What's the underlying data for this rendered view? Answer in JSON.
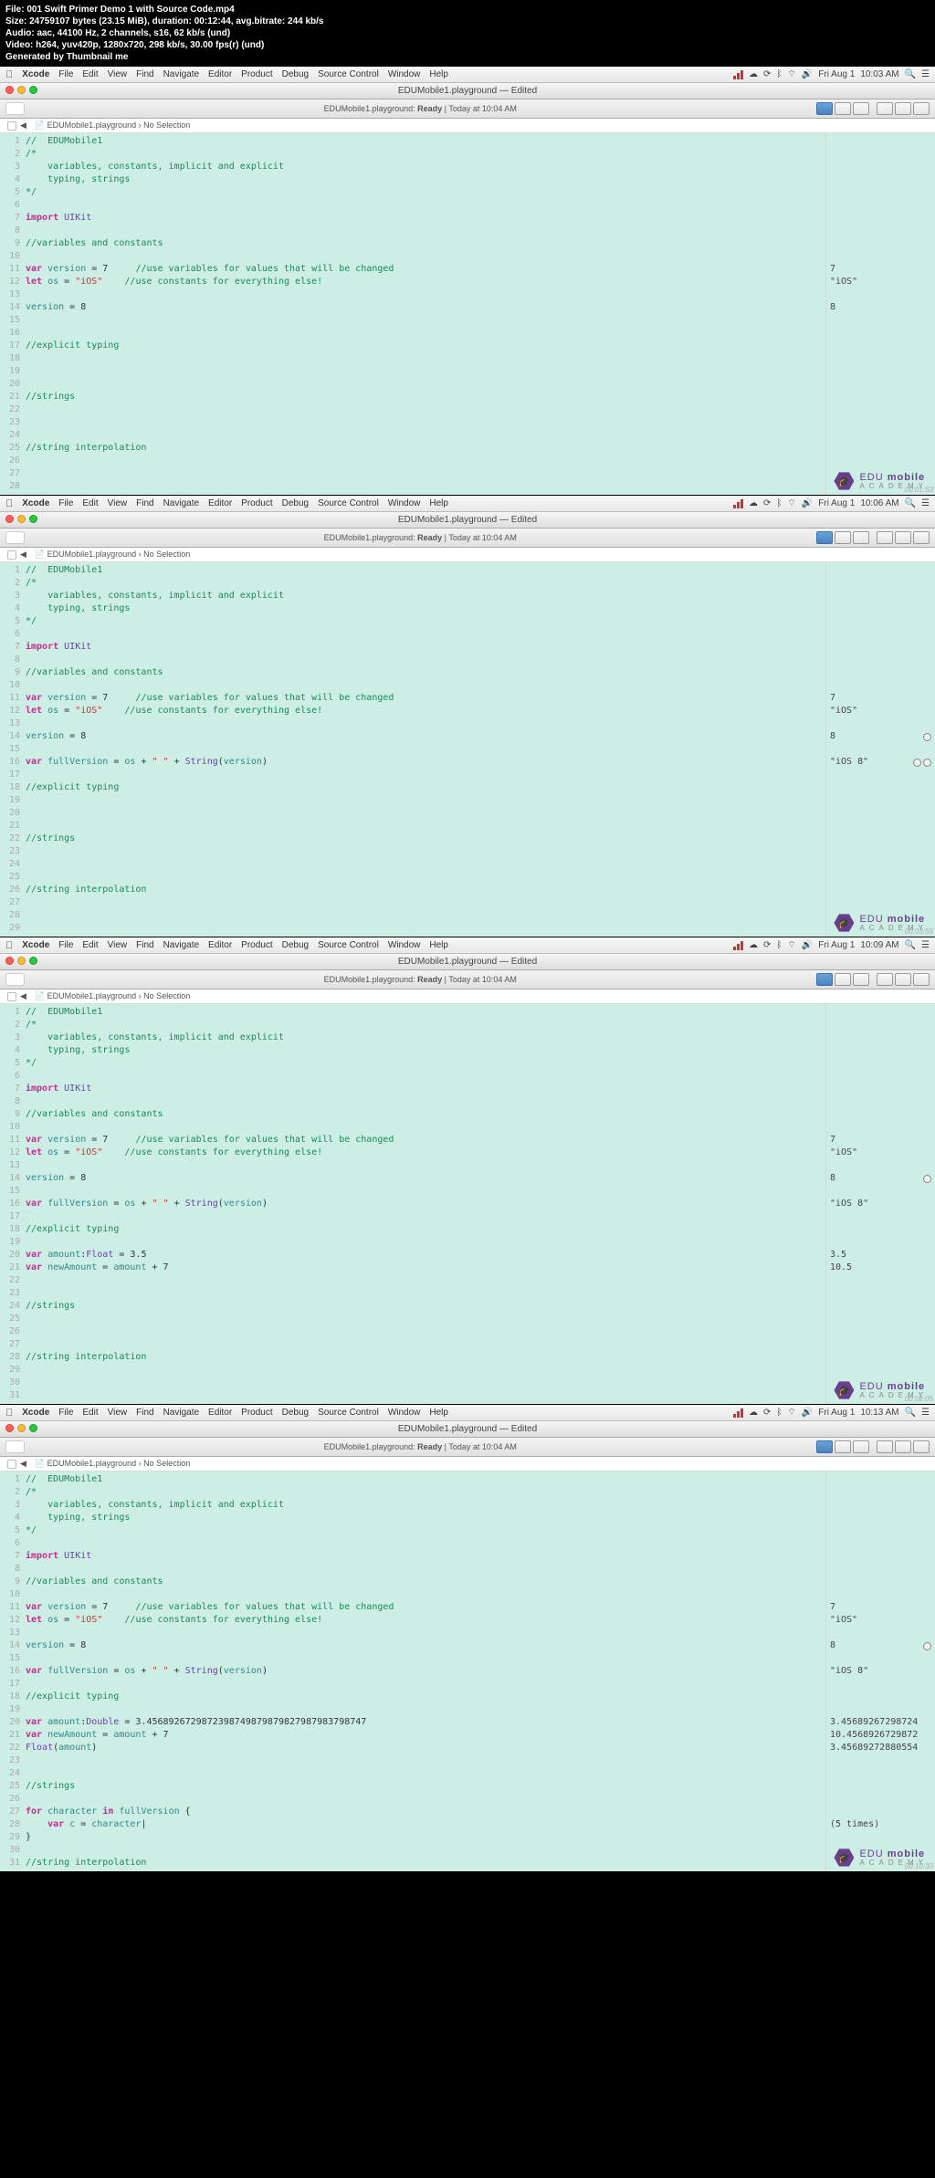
{
  "video_meta": {
    "file_lbl": "File:",
    "file_val": "001 Swift Primer Demo 1 with Source Code.mp4",
    "size_lbl": "Size:",
    "size_val": "24759107 bytes (23.15 MiB), duration: 00:12:44, avg.bitrate: 244 kb/s",
    "audio_lbl": "Audio:",
    "audio_val": "aac, 44100 Hz, 2 channels, s16, 62 kb/s (und)",
    "video_lbl": "Video:",
    "video_val": "h264, yuv420p, 1280x720, 298 kb/s, 30.00 fps(r) (und)",
    "gen": "Generated by Thumbnail me"
  },
  "menubar": {
    "app": "Xcode",
    "items": [
      "File",
      "Edit",
      "View",
      "Find",
      "Navigate",
      "Editor",
      "Product",
      "Debug",
      "Source Control",
      "Window",
      "Help"
    ],
    "day": "Fri Aug 1"
  },
  "titlebar_text": "EDUMobile1.playground — Edited",
  "toolbar_status_ready": "Ready",
  "toolbar_status_sep": " | ",
  "toolbar_status_time": "Today at 10:04 AM",
  "breadcrumb": {
    "file": "EDUMobile1.playground",
    "no_sel": "No Selection"
  },
  "logo": {
    "line1a": "EDU ",
    "line1b": "mobile",
    "line2": "ACADEMY"
  },
  "frames": [
    {
      "time": "10:03 AM",
      "corner": "00:01:53",
      "highlight": null,
      "lines": [
        {
          "n": 1,
          "html": "<span class='c-comment'>//  EDUMobile1</span>",
          "res": ""
        },
        {
          "n": 2,
          "html": "<span class='c-comment'>/*</span>",
          "res": ""
        },
        {
          "n": 3,
          "html": "<span class='c-comment'>    variables, constants, implicit and explicit</span>",
          "res": ""
        },
        {
          "n": 4,
          "html": "<span class='c-comment'>    typing, strings</span>",
          "res": ""
        },
        {
          "n": 5,
          "html": "<span class='c-comment'>*/</span>",
          "res": ""
        },
        {
          "n": 6,
          "html": "",
          "res": ""
        },
        {
          "n": 7,
          "html": "<span class='c-keyword'>import</span> <span class='c-type'>UIKit</span>",
          "res": ""
        },
        {
          "n": 8,
          "html": "",
          "res": ""
        },
        {
          "n": 9,
          "html": "<span class='c-comment'>//variables and constants</span>",
          "res": ""
        },
        {
          "n": 10,
          "html": "",
          "res": ""
        },
        {
          "n": 11,
          "html": "<span class='c-keyword'>var</span> <span class='c-ident'>version</span> = 7     <span class='c-comment'>//use variables for values that will be changed</span>",
          "res": "7"
        },
        {
          "n": 12,
          "html": "<span class='c-keyword'>let</span> <span class='c-ident'>os</span> = <span class='c-string'>\"iOS\"</span>    <span class='c-comment'>//use constants for everything else!</span>",
          "res": "\"iOS\""
        },
        {
          "n": 13,
          "html": "",
          "res": ""
        },
        {
          "n": 14,
          "html": "<span class='c-ident'>version</span> = 8",
          "res": "8"
        },
        {
          "n": 15,
          "html": "",
          "res": ""
        },
        {
          "n": 16,
          "html": "",
          "res": ""
        },
        {
          "n": 17,
          "html": "<span class='c-comment'>//explicit typing</span>",
          "res": ""
        },
        {
          "n": 18,
          "html": "",
          "res": ""
        },
        {
          "n": 19,
          "html": "",
          "res": ""
        },
        {
          "n": 20,
          "html": "",
          "res": ""
        },
        {
          "n": 21,
          "html": "<span class='c-comment'>//strings</span>",
          "res": ""
        },
        {
          "n": 22,
          "html": "",
          "res": ""
        },
        {
          "n": 23,
          "html": "",
          "res": ""
        },
        {
          "n": 24,
          "html": "",
          "res": ""
        },
        {
          "n": 25,
          "html": "<span class='c-comment'>//string interpolation</span>",
          "res": ""
        },
        {
          "n": 26,
          "html": "",
          "res": ""
        },
        {
          "n": 27,
          "html": "",
          "res": ""
        },
        {
          "n": 28,
          "html": "",
          "res": ""
        }
      ]
    },
    {
      "time": "10:06 AM",
      "corner": "00:03:59",
      "highlight": 16,
      "lines": [
        {
          "n": 1,
          "html": "<span class='c-comment'>//  EDUMobile1</span>",
          "res": ""
        },
        {
          "n": 2,
          "html": "<span class='c-comment'>/*</span>",
          "res": ""
        },
        {
          "n": 3,
          "html": "<span class='c-comment'>    variables, constants, implicit and explicit</span>",
          "res": ""
        },
        {
          "n": 4,
          "html": "<span class='c-comment'>    typing, strings</span>",
          "res": ""
        },
        {
          "n": 5,
          "html": "<span class='c-comment'>*/</span>",
          "res": ""
        },
        {
          "n": 6,
          "html": "",
          "res": ""
        },
        {
          "n": 7,
          "html": "<span class='c-keyword'>import</span> <span class='c-type'>UIKit</span>",
          "res": ""
        },
        {
          "n": 8,
          "html": "",
          "res": ""
        },
        {
          "n": 9,
          "html": "<span class='c-comment'>//variables and constants</span>",
          "res": ""
        },
        {
          "n": 10,
          "html": "",
          "res": ""
        },
        {
          "n": 11,
          "html": "<span class='c-keyword'>var</span> <span class='c-ident'>version</span> = 7     <span class='c-comment'>//use variables for values that will be changed</span>",
          "res": "7"
        },
        {
          "n": 12,
          "html": "<span class='c-keyword'>let</span> <span class='c-ident'>os</span> = <span class='c-string'>\"iOS\"</span>    <span class='c-comment'>//use constants for everything else!</span>",
          "res": "\"iOS\""
        },
        {
          "n": 13,
          "html": "",
          "res": ""
        },
        {
          "n": 14,
          "html": "<span class='c-ident'>version</span> = 8",
          "res": "8",
          "ind": "empty"
        },
        {
          "n": 15,
          "html": "",
          "res": ""
        },
        {
          "n": 16,
          "html": "<span class='c-keyword'>var</span> <span class='c-ident'>fullVersion</span> = <span class='c-ident'>os</span> + <span class='c-string'>\" \"</span> + <span class='c-type'>String</span>(<span class='c-ident'>version</span>)",
          "res": "\"iOS 8\"",
          "ind": "both"
        },
        {
          "n": 17,
          "html": "",
          "res": ""
        },
        {
          "n": 18,
          "html": "<span class='c-comment'>//explicit typing</span>",
          "res": ""
        },
        {
          "n": 19,
          "html": "",
          "res": ""
        },
        {
          "n": 20,
          "html": "",
          "res": ""
        },
        {
          "n": 21,
          "html": "",
          "res": ""
        },
        {
          "n": 22,
          "html": "<span class='c-comment'>//strings</span>",
          "res": ""
        },
        {
          "n": 23,
          "html": "",
          "res": ""
        },
        {
          "n": 24,
          "html": "",
          "res": ""
        },
        {
          "n": 25,
          "html": "",
          "res": ""
        },
        {
          "n": 26,
          "html": "<span class='c-comment'>//string interpolation</span>",
          "res": ""
        },
        {
          "n": 27,
          "html": "",
          "res": ""
        },
        {
          "n": 28,
          "html": "",
          "res": ""
        },
        {
          "n": 29,
          "html": "",
          "res": ""
        }
      ]
    },
    {
      "time": "10:09 AM",
      "corner": "00:06:05",
      "highlight": null,
      "lines": [
        {
          "n": 1,
          "html": "<span class='c-comment'>//  EDUMobile1</span>",
          "res": ""
        },
        {
          "n": 2,
          "html": "<span class='c-comment'>/*</span>",
          "res": ""
        },
        {
          "n": 3,
          "html": "<span class='c-comment'>    variables, constants, implicit and explicit</span>",
          "res": ""
        },
        {
          "n": 4,
          "html": "<span class='c-comment'>    typing, strings</span>",
          "res": ""
        },
        {
          "n": 5,
          "html": "<span class='c-comment'>*/</span>",
          "res": ""
        },
        {
          "n": 6,
          "html": "",
          "res": ""
        },
        {
          "n": 7,
          "html": "<span class='c-keyword'>import</span> <span class='c-type'>UIKit</span>",
          "res": ""
        },
        {
          "n": 8,
          "html": "",
          "res": ""
        },
        {
          "n": 9,
          "html": "<span class='c-comment'>//variables and constants</span>",
          "res": ""
        },
        {
          "n": 10,
          "html": "",
          "res": ""
        },
        {
          "n": 11,
          "html": "<span class='c-keyword'>var</span> <span class='c-ident'>version</span> = 7     <span class='c-comment'>//use variables for values that will be changed</span>",
          "res": "7"
        },
        {
          "n": 12,
          "html": "<span class='c-keyword'>let</span> <span class='c-ident'>os</span> = <span class='c-string'>\"iOS\"</span>    <span class='c-comment'>//use constants for everything else!</span>",
          "res": "\"iOS\""
        },
        {
          "n": 13,
          "html": "",
          "res": ""
        },
        {
          "n": 14,
          "html": "<span class='c-ident'>version</span> = 8",
          "res": "8",
          "ind": "empty"
        },
        {
          "n": 15,
          "html": "",
          "res": ""
        },
        {
          "n": 16,
          "html": "<span class='c-keyword'>var</span> <span class='c-ident'>fullVersion</span> = <span class='c-ident'>os</span> + <span class='c-string'>\" \"</span> + <span class='c-type'>String</span>(<span class='c-ident'>version</span>)",
          "res": "\"iOS 8\""
        },
        {
          "n": 17,
          "html": "",
          "res": ""
        },
        {
          "n": 18,
          "html": "<span class='c-comment'>//explicit typing</span>",
          "res": ""
        },
        {
          "n": 19,
          "html": "",
          "res": ""
        },
        {
          "n": 20,
          "html": "<span class='c-keyword'>var</span> <span class='c-ident'>amount</span>:<span class='c-type'>Float</span> = 3.5",
          "res": "3.5"
        },
        {
          "n": 21,
          "html": "<span class='c-keyword'>var</span> <span class='c-ident'>newAmount</span> = <span class='c-ident'>amount</span> + 7",
          "res": "10.5"
        },
        {
          "n": 22,
          "html": "",
          "res": ""
        },
        {
          "n": 23,
          "html": "",
          "res": ""
        },
        {
          "n": 24,
          "html": "<span class='c-comment'>//strings</span>",
          "res": ""
        },
        {
          "n": 25,
          "html": "",
          "res": ""
        },
        {
          "n": 26,
          "html": "",
          "res": ""
        },
        {
          "n": 27,
          "html": "",
          "res": ""
        },
        {
          "n": 28,
          "html": "<span class='c-comment'>//string interpolation</span>",
          "res": ""
        },
        {
          "n": 29,
          "html": "",
          "res": ""
        },
        {
          "n": 30,
          "html": "",
          "res": ""
        },
        {
          "n": 31,
          "html": "",
          "res": ""
        }
      ]
    },
    {
      "time": "10:13 AM",
      "corner": "00:10:30",
      "highlight": null,
      "lines": [
        {
          "n": 1,
          "html": "<span class='c-comment'>//  EDUMobile1</span>",
          "res": ""
        },
        {
          "n": 2,
          "html": "<span class='c-comment'>/*</span>",
          "res": ""
        },
        {
          "n": 3,
          "html": "<span class='c-comment'>    variables, constants, implicit and explicit</span>",
          "res": ""
        },
        {
          "n": 4,
          "html": "<span class='c-comment'>    typing, strings</span>",
          "res": ""
        },
        {
          "n": 5,
          "html": "<span class='c-comment'>*/</span>",
          "res": ""
        },
        {
          "n": 6,
          "html": "",
          "res": ""
        },
        {
          "n": 7,
          "html": "<span class='c-keyword'>import</span> <span class='c-type'>UIKit</span>",
          "res": ""
        },
        {
          "n": 8,
          "html": "",
          "res": ""
        },
        {
          "n": 9,
          "html": "<span class='c-comment'>//variables and constants</span>",
          "res": ""
        },
        {
          "n": 10,
          "html": "",
          "res": ""
        },
        {
          "n": 11,
          "html": "<span class='c-keyword'>var</span> <span class='c-ident'>version</span> = 7     <span class='c-comment'>//use variables for values that will be changed</span>",
          "res": "7"
        },
        {
          "n": 12,
          "html": "<span class='c-keyword'>let</span> <span class='c-ident'>os</span> = <span class='c-string'>\"iOS\"</span>    <span class='c-comment'>//use constants for everything else!</span>",
          "res": "\"iOS\""
        },
        {
          "n": 13,
          "html": "",
          "res": ""
        },
        {
          "n": 14,
          "html": "<span class='c-ident'>version</span> = 8",
          "res": "8",
          "ind": "empty"
        },
        {
          "n": 15,
          "html": "",
          "res": ""
        },
        {
          "n": 16,
          "html": "<span class='c-keyword'>var</span> <span class='c-ident'>fullVersion</span> = <span class='c-ident'>os</span> + <span class='c-string'>\" \"</span> + <span class='c-type'>String</span>(<span class='c-ident'>version</span>)",
          "res": "\"iOS 8\""
        },
        {
          "n": 17,
          "html": "",
          "res": ""
        },
        {
          "n": 18,
          "html": "<span class='c-comment'>//explicit typing</span>",
          "res": ""
        },
        {
          "n": 19,
          "html": "",
          "res": ""
        },
        {
          "n": 20,
          "html": "<span class='c-keyword'>var</span> <span class='c-ident'>amount</span>:<span class='c-type'>Double</span> = 3.45689267298723987498798798279879837987<span>47</span>",
          "res": "3.45689267298724"
        },
        {
          "n": 21,
          "html": "<span class='c-keyword'>var</span> <span class='c-ident'>newAmount</span> = <span class='c-ident'>amount</span> + 7",
          "res": "10.4568926729872"
        },
        {
          "n": 22,
          "html": "<span class='c-type'>Float</span>(<span class='c-ident'>amount</span>)",
          "res": "3.45689272880554"
        },
        {
          "n": 23,
          "html": "",
          "res": ""
        },
        {
          "n": 24,
          "html": "",
          "res": ""
        },
        {
          "n": 25,
          "html": "<span class='c-comment'>//strings</span>",
          "res": ""
        },
        {
          "n": 26,
          "html": "",
          "res": ""
        },
        {
          "n": 27,
          "html": "<span class='c-keyword'>for</span> <span class='c-ident'>character</span> <span class='c-keyword'>in</span> <span class='c-ident'>fullVersion</span> {",
          "res": ""
        },
        {
          "n": 28,
          "html": "    <span class='c-keyword'>var</span> <span class='c-ident'>c</span> = <span class='c-ident'>character</span>|",
          "res": "(5 times)"
        },
        {
          "n": 29,
          "html": "}",
          "res": ""
        },
        {
          "n": 30,
          "html": "",
          "res": ""
        },
        {
          "n": 31,
          "html": "<span class='c-comment'>//string interpolation</span>",
          "res": ""
        }
      ]
    }
  ]
}
